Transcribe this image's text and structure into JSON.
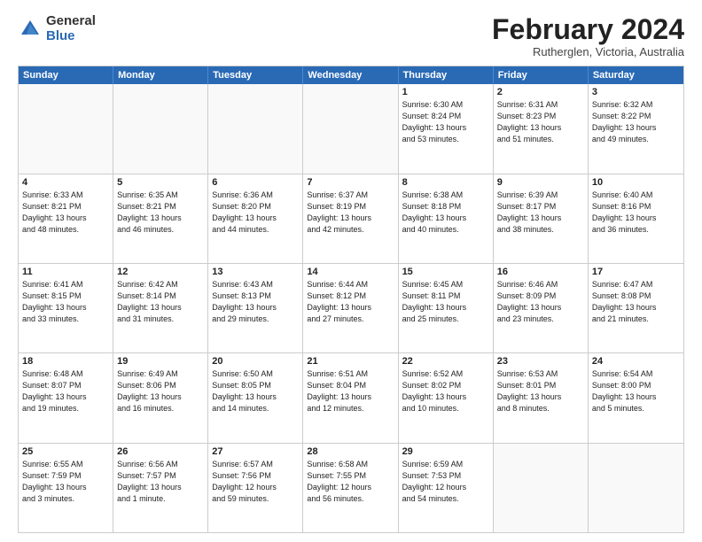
{
  "logo": {
    "general": "General",
    "blue": "Blue"
  },
  "title": "February 2024",
  "subtitle": "Rutherglen, Victoria, Australia",
  "headers": [
    "Sunday",
    "Monday",
    "Tuesday",
    "Wednesday",
    "Thursday",
    "Friday",
    "Saturday"
  ],
  "weeks": [
    [
      {
        "day": "",
        "info": ""
      },
      {
        "day": "",
        "info": ""
      },
      {
        "day": "",
        "info": ""
      },
      {
        "day": "",
        "info": ""
      },
      {
        "day": "1",
        "info": "Sunrise: 6:30 AM\nSunset: 8:24 PM\nDaylight: 13 hours\nand 53 minutes."
      },
      {
        "day": "2",
        "info": "Sunrise: 6:31 AM\nSunset: 8:23 PM\nDaylight: 13 hours\nand 51 minutes."
      },
      {
        "day": "3",
        "info": "Sunrise: 6:32 AM\nSunset: 8:22 PM\nDaylight: 13 hours\nand 49 minutes."
      }
    ],
    [
      {
        "day": "4",
        "info": "Sunrise: 6:33 AM\nSunset: 8:21 PM\nDaylight: 13 hours\nand 48 minutes."
      },
      {
        "day": "5",
        "info": "Sunrise: 6:35 AM\nSunset: 8:21 PM\nDaylight: 13 hours\nand 46 minutes."
      },
      {
        "day": "6",
        "info": "Sunrise: 6:36 AM\nSunset: 8:20 PM\nDaylight: 13 hours\nand 44 minutes."
      },
      {
        "day": "7",
        "info": "Sunrise: 6:37 AM\nSunset: 8:19 PM\nDaylight: 13 hours\nand 42 minutes."
      },
      {
        "day": "8",
        "info": "Sunrise: 6:38 AM\nSunset: 8:18 PM\nDaylight: 13 hours\nand 40 minutes."
      },
      {
        "day": "9",
        "info": "Sunrise: 6:39 AM\nSunset: 8:17 PM\nDaylight: 13 hours\nand 38 minutes."
      },
      {
        "day": "10",
        "info": "Sunrise: 6:40 AM\nSunset: 8:16 PM\nDaylight: 13 hours\nand 36 minutes."
      }
    ],
    [
      {
        "day": "11",
        "info": "Sunrise: 6:41 AM\nSunset: 8:15 PM\nDaylight: 13 hours\nand 33 minutes."
      },
      {
        "day": "12",
        "info": "Sunrise: 6:42 AM\nSunset: 8:14 PM\nDaylight: 13 hours\nand 31 minutes."
      },
      {
        "day": "13",
        "info": "Sunrise: 6:43 AM\nSunset: 8:13 PM\nDaylight: 13 hours\nand 29 minutes."
      },
      {
        "day": "14",
        "info": "Sunrise: 6:44 AM\nSunset: 8:12 PM\nDaylight: 13 hours\nand 27 minutes."
      },
      {
        "day": "15",
        "info": "Sunrise: 6:45 AM\nSunset: 8:11 PM\nDaylight: 13 hours\nand 25 minutes."
      },
      {
        "day": "16",
        "info": "Sunrise: 6:46 AM\nSunset: 8:09 PM\nDaylight: 13 hours\nand 23 minutes."
      },
      {
        "day": "17",
        "info": "Sunrise: 6:47 AM\nSunset: 8:08 PM\nDaylight: 13 hours\nand 21 minutes."
      }
    ],
    [
      {
        "day": "18",
        "info": "Sunrise: 6:48 AM\nSunset: 8:07 PM\nDaylight: 13 hours\nand 19 minutes."
      },
      {
        "day": "19",
        "info": "Sunrise: 6:49 AM\nSunset: 8:06 PM\nDaylight: 13 hours\nand 16 minutes."
      },
      {
        "day": "20",
        "info": "Sunrise: 6:50 AM\nSunset: 8:05 PM\nDaylight: 13 hours\nand 14 minutes."
      },
      {
        "day": "21",
        "info": "Sunrise: 6:51 AM\nSunset: 8:04 PM\nDaylight: 13 hours\nand 12 minutes."
      },
      {
        "day": "22",
        "info": "Sunrise: 6:52 AM\nSunset: 8:02 PM\nDaylight: 13 hours\nand 10 minutes."
      },
      {
        "day": "23",
        "info": "Sunrise: 6:53 AM\nSunset: 8:01 PM\nDaylight: 13 hours\nand 8 minutes."
      },
      {
        "day": "24",
        "info": "Sunrise: 6:54 AM\nSunset: 8:00 PM\nDaylight: 13 hours\nand 5 minutes."
      }
    ],
    [
      {
        "day": "25",
        "info": "Sunrise: 6:55 AM\nSunset: 7:59 PM\nDaylight: 13 hours\nand 3 minutes."
      },
      {
        "day": "26",
        "info": "Sunrise: 6:56 AM\nSunset: 7:57 PM\nDaylight: 13 hours\nand 1 minute."
      },
      {
        "day": "27",
        "info": "Sunrise: 6:57 AM\nSunset: 7:56 PM\nDaylight: 12 hours\nand 59 minutes."
      },
      {
        "day": "28",
        "info": "Sunrise: 6:58 AM\nSunset: 7:55 PM\nDaylight: 12 hours\nand 56 minutes."
      },
      {
        "day": "29",
        "info": "Sunrise: 6:59 AM\nSunset: 7:53 PM\nDaylight: 12 hours\nand 54 minutes."
      },
      {
        "day": "",
        "info": ""
      },
      {
        "day": "",
        "info": ""
      }
    ]
  ]
}
